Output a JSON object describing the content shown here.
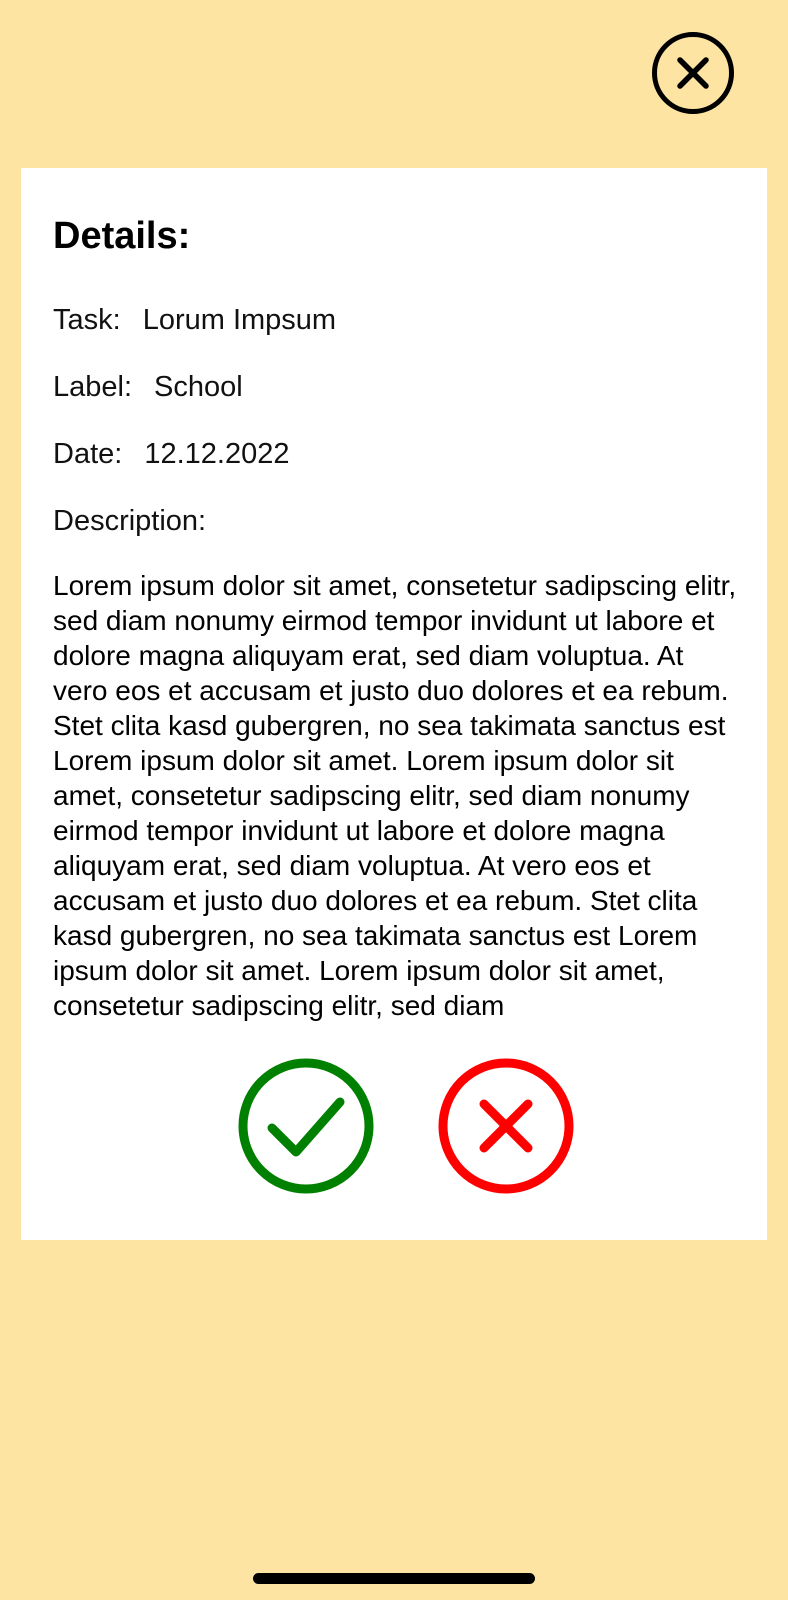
{
  "header": {
    "close_icon": "close-circle-icon"
  },
  "details": {
    "heading": "Details:",
    "task": {
      "label": "Task:",
      "value": "Lorum Impsum"
    },
    "label": {
      "label": "Label:",
      "value": "School"
    },
    "date": {
      "label": "Date:",
      "value": "12.12.2022"
    },
    "description": {
      "label": "Description:",
      "text": "Lorem ipsum dolor sit amet, consetetur sadipscing elitr, sed diam nonumy eirmod tempor invidunt ut labore et dolore magna aliquyam erat, sed diam voluptua. At vero eos et accusam et justo duo dolores et ea rebum. Stet clita kasd gubergren, no sea takimata sanctus est Lorem ipsum dolor sit amet. Lorem ipsum dolor sit amet, consetetur sadipscing elitr, sed diam nonumy eirmod tempor invidunt ut labore et dolore magna aliquyam erat, sed diam voluptua. At vero eos et accusam et justo duo dolores et ea rebum. Stet clita kasd gubergren, no sea takimata sanctus est Lorem ipsum dolor sit amet. Lorem ipsum dolor sit amet, consetetur sadipscing elitr, sed diam"
    }
  },
  "actions": {
    "accept_icon": "check-circle-icon",
    "reject_icon": "x-circle-icon"
  },
  "colors": {
    "background": "#FDE4A3",
    "card": "#FFFFFF",
    "accept": "#008000",
    "reject": "#FF0000",
    "close": "#000000"
  }
}
